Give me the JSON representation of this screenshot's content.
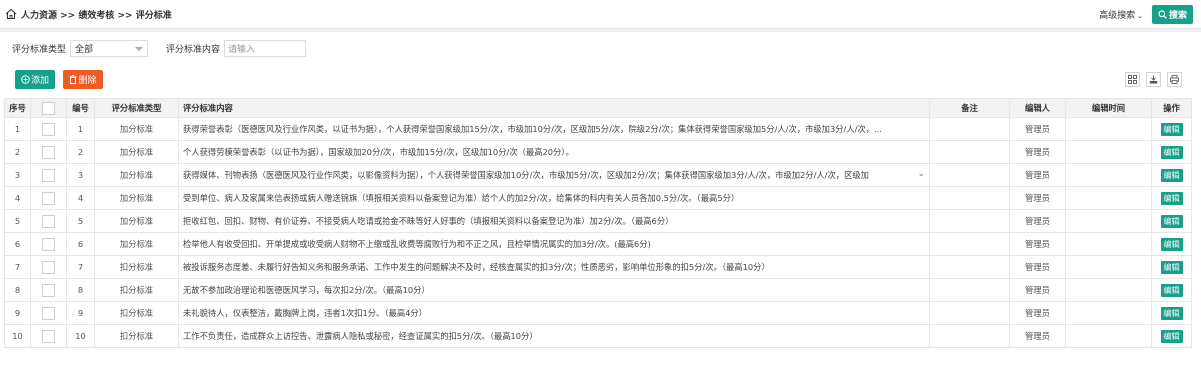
{
  "breadcrumb": "人力资源 >> 绩效考核 >> 评分标准",
  "header": {
    "advanced_search": "高级搜索",
    "search_button": "搜索"
  },
  "filters": {
    "type_label": "评分标准类型",
    "type_value": "全部",
    "content_label": "评分标准内容",
    "content_placeholder": "请输入"
  },
  "toolbar": {
    "add_label": "添加",
    "delete_label": "删除"
  },
  "table": {
    "columns": [
      "序号",
      "",
      "编号",
      "评分标准类型",
      "评分标准内容",
      "备注",
      "编辑人",
      "编辑时间",
      "操作"
    ],
    "rows": [
      {
        "seq": "1",
        "num": "1",
        "type": "加分标准",
        "content": "获得荣誉表彰（医德医风及行业作风类，以证书为据），个人获得荣誉国家级加15分/次，市级加10分/次，区级加5分/次，院级2分/次；集体获得荣誉国家级加5分/人/次，市级加3分/人/次，...",
        "remark": "",
        "editor": "管理员",
        "time": "",
        "action": "编辑"
      },
      {
        "seq": "2",
        "num": "2",
        "type": "加分标准",
        "content": "个人获得劳模荣誉表彰（以证书为据），国家级加20分/次，市级加15分/次，区级加10分/次（最高20分）。",
        "remark": "",
        "editor": "管理员",
        "time": "",
        "action": "编辑"
      },
      {
        "seq": "3",
        "num": "3",
        "type": "加分标准",
        "content": "获得媒体、刊物表扬（医德医风及行业作风类，以影像资料为据），个人获得荣誉国家级加10分/次，市级加5分/次，区级加2分/次；集体获得国家级加3分/人/次，市级加2分/人/次，区级加",
        "remark": "",
        "editor": "管理员",
        "time": "",
        "action": "编辑"
      },
      {
        "seq": "4",
        "num": "4",
        "type": "加分标准",
        "content": "受到单位、病人及家属来信表扬或病人赠送锦旗（填报相关资料以备案登记为准）给个人的加2分/次，给集体的科内有关人员各加0.5分/次。（最高5分）",
        "remark": "",
        "editor": "管理员",
        "time": "",
        "action": "编辑"
      },
      {
        "seq": "5",
        "num": "5",
        "type": "加分标准",
        "content": "拒收红包、回扣、财物、有价证券、不接受病人吃请或拾金不昧等好人好事的（填报相关资料以备案登记为准）加2分/次。（最高6分）",
        "remark": "",
        "editor": "管理员",
        "time": "",
        "action": "编辑"
      },
      {
        "seq": "6",
        "num": "6",
        "type": "加分标准",
        "content": "检举他人有收受回扣、开单提成或收受病人财物不上缴或乱收费等腐败行为和不正之风，且检举情况属实的加3分/次。(最高6分)",
        "remark": "",
        "editor": "管理员",
        "time": "",
        "action": "编辑"
      },
      {
        "seq": "7",
        "num": "7",
        "type": "扣分标准",
        "content": "被投诉服务态度差、未履行好告知义务和服务承诺、工作中发生的问题解决不及时，经核查属实的扣3分/次；性质恶劣，影响单位形象的扣5分/次。（最高10分）",
        "remark": "",
        "editor": "管理员",
        "time": "",
        "action": "编辑"
      },
      {
        "seq": "8",
        "num": "8",
        "type": "扣分标准",
        "content": "无故不参加政治理论和医德医风学习，每次扣2分/次。（最高10分）",
        "remark": "",
        "editor": "管理员",
        "time": "",
        "action": "编辑"
      },
      {
        "seq": "9",
        "num": "9",
        "type": "扣分标准",
        "content": "未礼貌待人，仪表整洁，戴胸牌上岗，违者1次扣1分。（最高4分）",
        "remark": "",
        "editor": "管理员",
        "time": "",
        "action": "编辑"
      },
      {
        "seq": "10",
        "num": "10",
        "type": "扣分标准",
        "content": "工作不负责任，造成群众上访控告、泄露病人隐私或秘密，经查证属实的扣5分/次。（最高10分）",
        "remark": "",
        "editor": "管理员",
        "time": "",
        "action": "编辑"
      }
    ]
  }
}
